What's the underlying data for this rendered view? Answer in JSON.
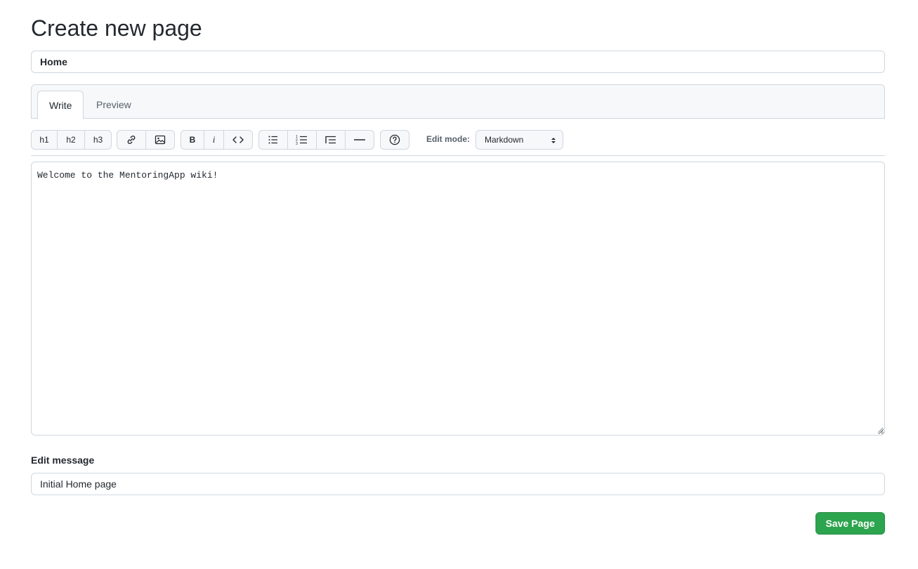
{
  "page": {
    "title": "Create new page"
  },
  "form": {
    "page_title_value": "Home",
    "tabs": [
      {
        "label": "Write",
        "active": true
      },
      {
        "label": "Preview",
        "active": false
      }
    ],
    "toolbar": {
      "h1": "h1",
      "h2": "h2",
      "h3": "h3",
      "bold": "B",
      "italic": "i",
      "icons": [
        "link-icon",
        "image-icon",
        "code-icon",
        "unordered-list-icon",
        "ordered-list-icon",
        "quote-icon",
        "horizontal-rule-icon",
        "help-icon"
      ]
    },
    "edit_mode": {
      "label": "Edit mode:",
      "selected": "Markdown"
    },
    "body_text": "Welcome to the MentoringApp wiki!",
    "edit_message": {
      "label": "Edit message",
      "value": "Initial Home page"
    },
    "save_label": "Save Page"
  },
  "colors": {
    "accent_green": "#2da44e",
    "border": "#d0d7de",
    "tab_bg": "#f6f8fa",
    "text": "#24292f",
    "muted": "#57606a"
  }
}
